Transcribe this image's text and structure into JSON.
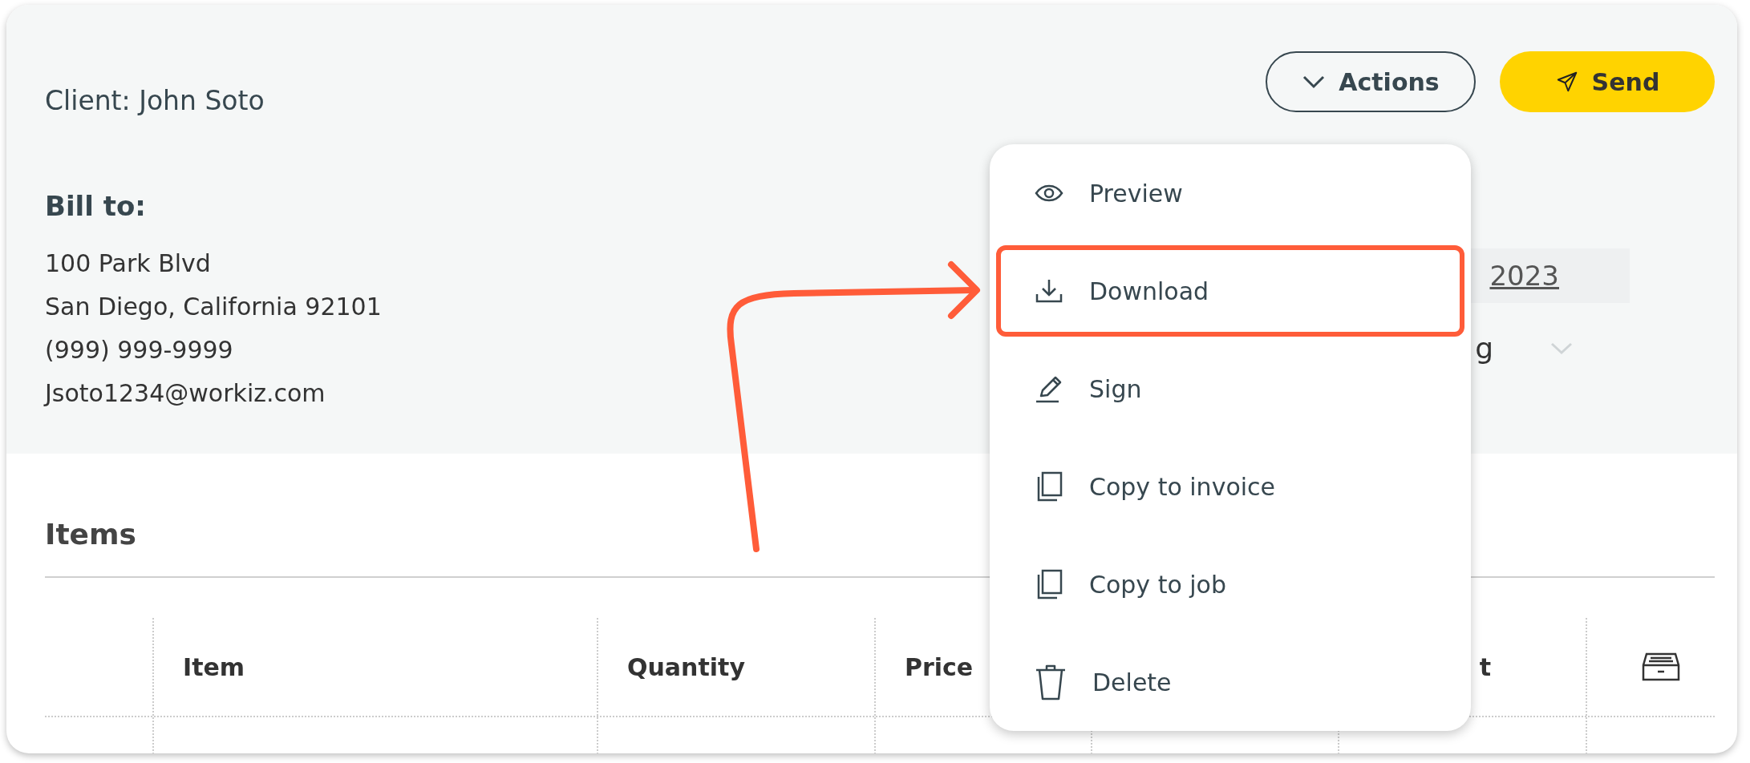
{
  "header": {
    "client": "Client: John Soto",
    "actions_button": "Actions",
    "send_button": "Send"
  },
  "bill_to": {
    "title": "Bill to:",
    "lines": [
      "100 Park Blvd",
      "San Diego, California 92101",
      "(999) 999-9999",
      "Jsoto1234@workiz.com"
    ]
  },
  "partial_fields": {
    "date": "2023",
    "select": "g"
  },
  "items": {
    "title": "Items",
    "columns": [
      {
        "kind": "blank"
      },
      {
        "kind": "text",
        "label": "Item"
      },
      {
        "kind": "text",
        "label": "Quantity"
      },
      {
        "kind": "text",
        "label": "Price"
      },
      {
        "kind": "blank"
      },
      {
        "kind": "text",
        "label": "t"
      },
      {
        "kind": "icon"
      }
    ]
  },
  "menu": {
    "items": [
      {
        "kind": "eye",
        "label": "Preview",
        "highlighted": false
      },
      {
        "kind": "download",
        "label": "Download",
        "highlighted": true
      },
      {
        "kind": "pen",
        "label": "Sign",
        "highlighted": false
      },
      {
        "kind": "copy",
        "label": "Copy to invoice",
        "highlighted": false
      },
      {
        "kind": "copy",
        "label": "Copy to job",
        "highlighted": false
      },
      {
        "kind": "trash",
        "label": "Delete",
        "highlighted": false
      }
    ]
  }
}
